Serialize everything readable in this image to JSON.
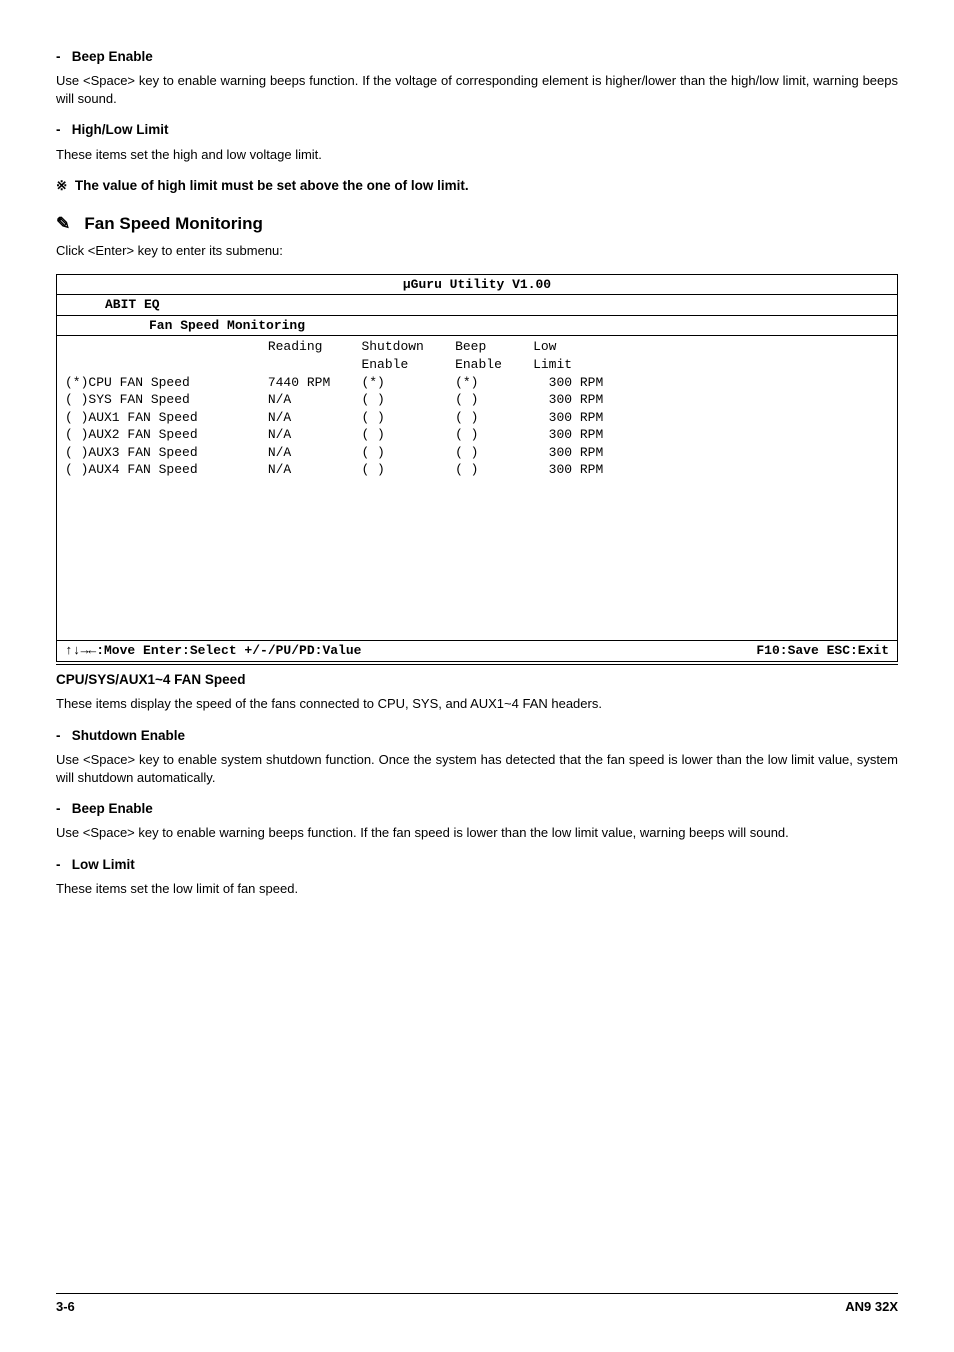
{
  "sec1": {
    "title": "Beep Enable",
    "body": "Use <Space> key to enable warning beeps function. If the voltage of corresponding element is higher/lower than the high/low limit, warning beeps will sound."
  },
  "sec2": {
    "title": "High/Low Limit",
    "body": "These items set the high and low voltage limit."
  },
  "note1": "The value of high limit must be set above the one of low limit.",
  "sec3": {
    "title": "Fan Speed Monitoring",
    "intro": "Click <Enter> key to enter its submenu:"
  },
  "table": {
    "title": "µGuru Utility V1.00",
    "sub1": "ABIT EQ",
    "sub2": "Fan Speed Monitoring",
    "hdr": {
      "c1": "Reading",
      "c2": "Shutdown",
      "c3": "Beep",
      "c4": "Low"
    },
    "hdr2": {
      "c2": "Enable",
      "c3": "Enable",
      "c4": "Limit"
    },
    "rows": [
      {
        "name": "(*)CPU FAN Speed",
        "reading": "7440 RPM",
        "sd": "(*)",
        "beep": "(*)",
        "low": "300 RPM"
      },
      {
        "name": "( )SYS FAN Speed",
        "reading": "N/A",
        "sd": "( )",
        "beep": "( )",
        "low": "300 RPM"
      },
      {
        "name": "( )AUX1 FAN Speed",
        "reading": "N/A",
        "sd": "( )",
        "beep": "( )",
        "low": "300 RPM"
      },
      {
        "name": "( )AUX2 FAN Speed",
        "reading": "N/A",
        "sd": "( )",
        "beep": "( )",
        "low": "300 RPM"
      },
      {
        "name": "( )AUX3 FAN Speed",
        "reading": "N/A",
        "sd": "( )",
        "beep": "( )",
        "low": "300 RPM"
      },
      {
        "name": "( )AUX4 FAN Speed",
        "reading": "N/A",
        "sd": "( )",
        "beep": "( )",
        "low": "300 RPM"
      }
    ],
    "foot_left": "↑↓→←:Move  Enter:Select  +/-/PU/PD:Value",
    "foot_right": "F10:Save  ESC:Exit"
  },
  "sec4": {
    "title": "CPU/SYS/AUX1~4 FAN Speed",
    "body": "These items display the speed of the fans connected to CPU, SYS, and AUX1~4 FAN headers."
  },
  "sec5": {
    "title": "Shutdown Enable",
    "body": "Use <Space> key to enable system shutdown function. Once the system has detected that the fan speed is lower than the low limit value, system will shutdown automatically."
  },
  "sec6": {
    "title": "Beep Enable",
    "body": "Use <Space> key to enable warning beeps function. If the fan speed is lower than the low limit value, warning beeps will sound."
  },
  "sec7": {
    "title": "Low Limit",
    "body": "These items set the low limit of fan speed."
  },
  "footer": {
    "left": "3-6",
    "right": "AN9 32X"
  }
}
